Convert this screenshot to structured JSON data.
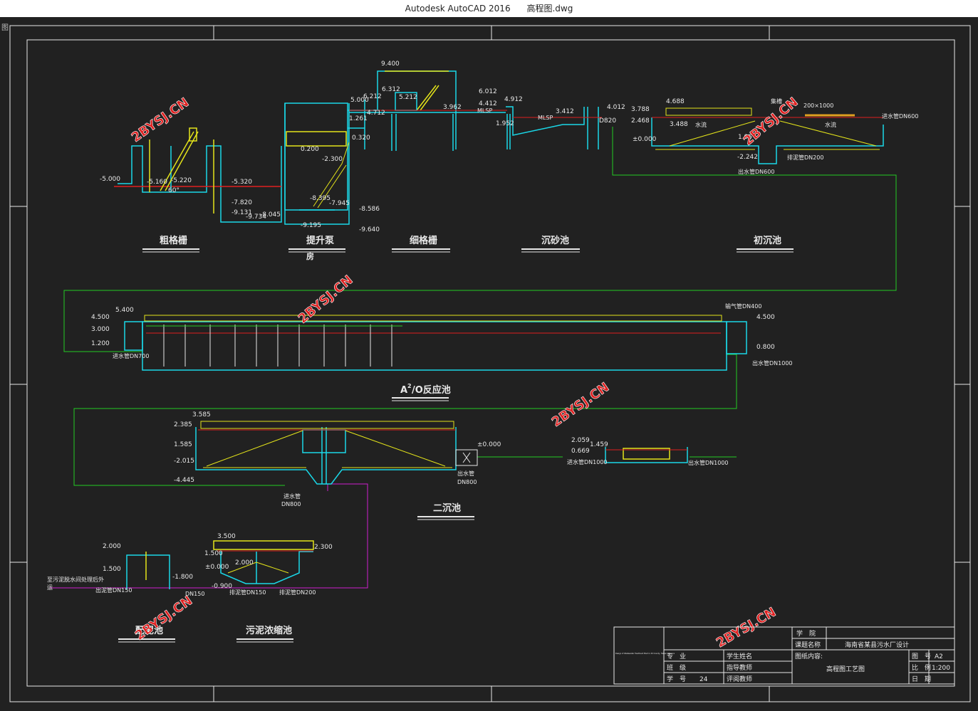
{
  "window": {
    "title_app": "Autodesk AutoCAD 2016",
    "title_file": "高程图.dwg",
    "corner_glyph": "图"
  },
  "colors": {
    "background": "#212121",
    "cyan": "#1ad8e8",
    "yellow": "#e4e41a",
    "green": "#22cc22",
    "red": "#e02020",
    "white": "#e8e8e8",
    "magenta": "#d020d0"
  },
  "watermark": "2BYSJ.CN",
  "sections": {
    "coarse_screen": "粗格栅",
    "lift_pump": "提升泵",
    "lift_pump_2": "房",
    "fine_screen": "细格栅",
    "grit_chamber": "沉砂池",
    "primary_clarifier": "初沉池",
    "a2o_prefix": "A",
    "a2o_sup": "2",
    "a2o_suffix": "/O反应池",
    "secondary_clarifier": "二沉池",
    "sludge_well": "配泥池",
    "sludge_thickener": "污泥浓缩池"
  },
  "elevations": {
    "e1": "-5.000",
    "e2": "-5.160",
    "e3": "-5.220",
    "e4": "60°",
    "e5": "-5.320",
    "e6": "-7.820",
    "e7": "-9.131",
    "e8": "-9.734",
    "e9": "-8.045",
    "e10": "0.200",
    "e11": "-2.300",
    "e12": "-8.395",
    "e13": "-7.945",
    "e14": "-8.586",
    "e15": "-9.640",
    "e16": "-9.195",
    "e17": "0.320",
    "e18": "1.261",
    "e19": "9.400",
    "e20": "6.312",
    "e21": "6.212",
    "e22": "5.212",
    "e23": "5.000",
    "e24": "4.712",
    "e25": "3.962",
    "e26": "6.012",
    "e27": "4.412",
    "e28": "4.912",
    "e29": "3.412",
    "e30": "1.952",
    "e31": "4.012",
    "e32": "D820",
    "e33": "3.788",
    "e34": "4.688",
    "e35": "2.468",
    "e36": "3.488",
    "e37": "±0.000",
    "e38": "1.95",
    "e39": "-2.242",
    "e40": "5.400",
    "e41": "4.500",
    "e42": "3.000",
    "e43": "1.200",
    "e44": "4.500",
    "e45": "0.800",
    "e46": "3.585",
    "e47": "2.385",
    "e48": "1.585",
    "e49": "-2.015",
    "e50": "-4.445",
    "e51": "±0.000",
    "e52": "2.059",
    "e53": "1.459",
    "e54": "0.669",
    "e55": "3.500",
    "e56": "2.300",
    "e57": "1.500",
    "e58": "2.000",
    "e59": "±0.000",
    "e60": "-0.900",
    "e61": "2.000",
    "e62": "1.500",
    "e63": "-1.800"
  },
  "pipe_labels": {
    "p1": "进水管DN600",
    "p2": "出水管DN600",
    "p3": "排泥管DN200",
    "p4": "200×1000",
    "p5": "集槽",
    "p6": "水流",
    "p7": "水流",
    "p8": "进水管DN700",
    "p9": "出水管DN1000",
    "p10": "输气管DN400",
    "p11": "出水管",
    "p12": "DN800",
    "p13": "进水管",
    "p14": "DN800",
    "p15": "进水管DN1000",
    "p16": "出水管DN1000",
    "p17": "排泥管DN150",
    "p18": "排泥管DN200",
    "p19": "出泥管DN150",
    "p20": "DN150",
    "p21": "至污泥脱水间处理后外",
    "p22": "运",
    "p23": "MLSP",
    "p24": "MLSP"
  },
  "title_block": {
    "school_label": "学　院",
    "project_label": "课题名称",
    "project_value": "海南省某县污水厂设计",
    "drawing_label": "图纸内容:",
    "drawing_value": "高程图工艺图",
    "major_label": "专　业",
    "student_label": "学生姓名",
    "class_label": "班　级",
    "advisor_label": "指导教师",
    "number_label": "学　号",
    "number_value": "24",
    "review_label": "评阅教师",
    "sheet_label": "图　号",
    "sheet_value": "A2",
    "scale_label": "比　例",
    "scale_value": "1:200",
    "date_label": "日　期",
    "small_note": "Design of Wastewater Treatment Plant in XX County, Hainan Province"
  }
}
